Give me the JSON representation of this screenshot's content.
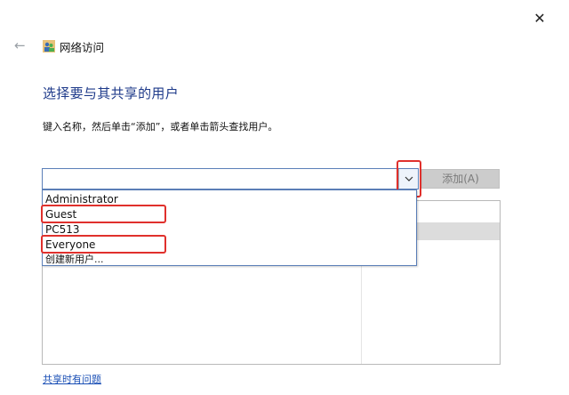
{
  "window": {
    "title": "网络访问",
    "close_glyph": "✕",
    "back_glyph": "←"
  },
  "main": {
    "heading": "选择要与其共享的用户",
    "instruction": "键入名称，然后单击“添加”，或者单击箭头查找用户。",
    "combo_value": "",
    "add_button_label": "添加(A)",
    "dropdown_options": [
      "Administrator",
      "Guest",
      "PC513",
      "Everyone",
      "创建新用户..."
    ],
    "help_link": "共享时有问题"
  },
  "icons": {
    "app": "network-users-icon",
    "back": "back-arrow-icon",
    "close": "close-icon",
    "dropdown": "chevron-down-icon"
  },
  "colors": {
    "heading": "#1e3a8a",
    "link": "#1a4fb5",
    "highlight": "#e0302c",
    "combo_border": "#5b7fb8",
    "disabled_button": "#cccccc"
  }
}
